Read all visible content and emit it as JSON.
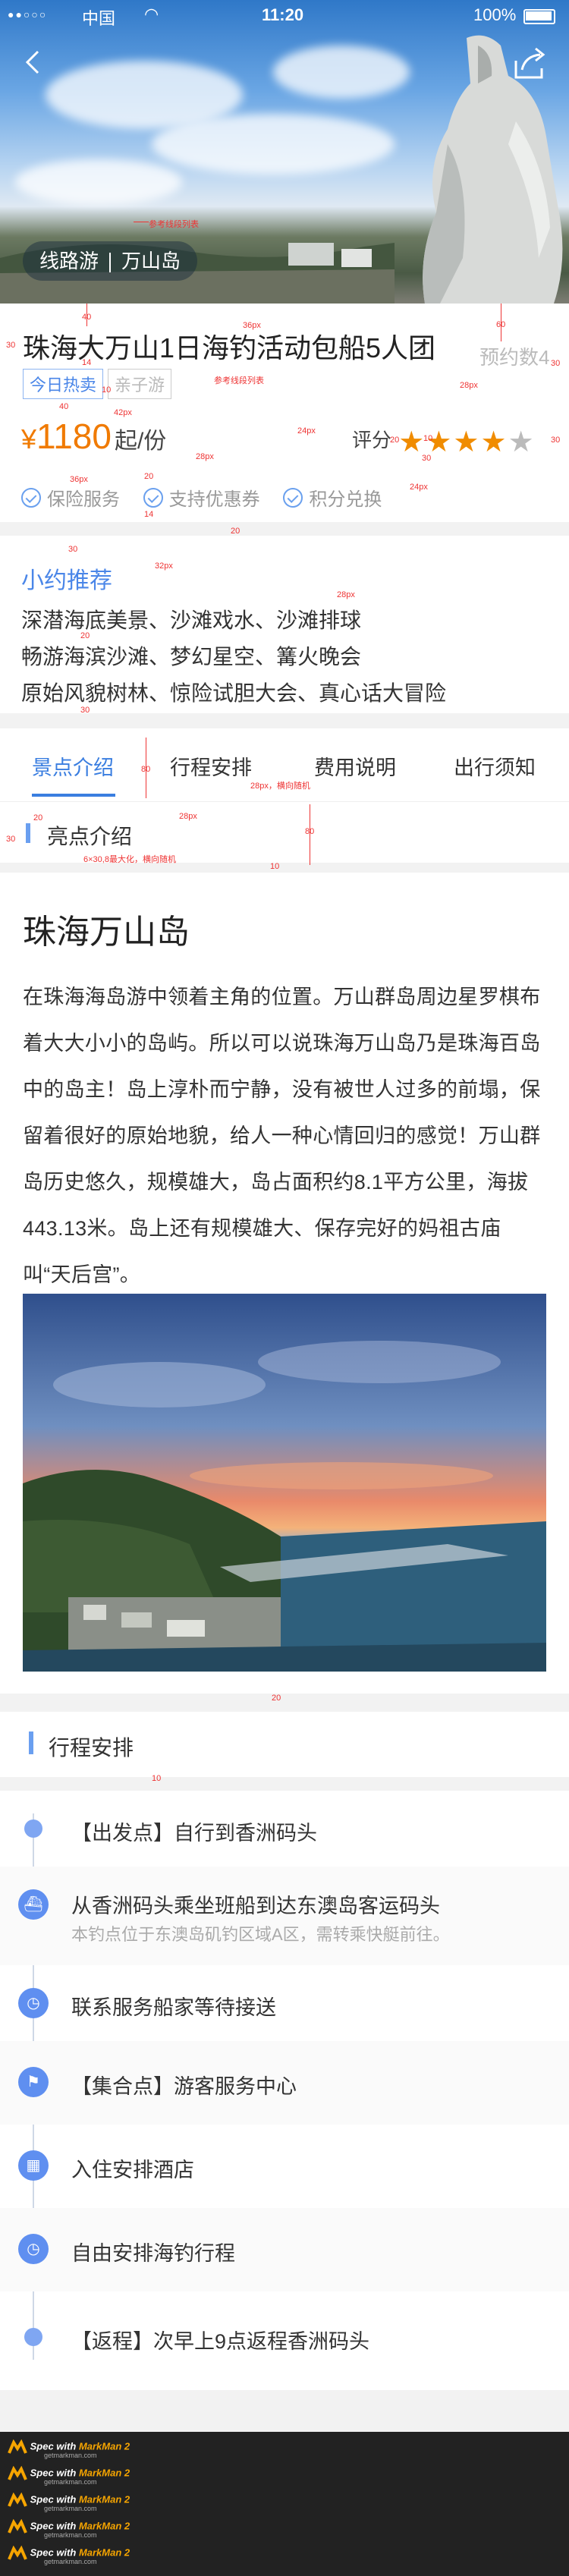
{
  "status_bar": {
    "signal": "●●○○○",
    "carrier": "中国",
    "time": "11:20",
    "battery": "100%"
  },
  "hero": {
    "tag_route": "线路游",
    "tag_place": "万山岛"
  },
  "product": {
    "title": "珠海大万山1日海钓活动包船5人团",
    "reserved": "预约数4",
    "tags": [
      "今日热卖",
      "亲子游"
    ],
    "price_symbol": "¥",
    "price": "1180",
    "price_unit": "起/份",
    "rating_label": "评分",
    "rating": 4,
    "rating_max": 5,
    "services": [
      "保险服务",
      "支持优惠券",
      "积分兑换"
    ]
  },
  "recommend": {
    "heading": "小约推荐",
    "lines": [
      "深潜海底美景、沙滩戏水、沙滩排球",
      "畅游海滨沙滩、梦幻星空、篝火晚会",
      "原始风貌树林、惊险试胆大会、真心话大冒险"
    ]
  },
  "tabs": [
    "景点介绍",
    "行程安排",
    "费用说明",
    "出行须知"
  ],
  "highlights_title": "亮点介绍",
  "article": {
    "title": "珠海万山岛",
    "body": "在珠海海岛游中领着主角的位置。万山群岛周边星罗棋布着大大小小的岛屿。所以可以说珠海万山岛乃是珠海百岛中的岛主！岛上淳朴而宁静，没有被世人过多的前塌，保留着很好的原始地貌，给人一种心情回归的感觉！万山群岛历史悠久，规模雄大，岛占面积约8.1平方公里，海拔443.13米。岛上还有规模雄大、保存完好的妈祖古庙叫“天后宫”。"
  },
  "itinerary": {
    "title": "行程安排",
    "items": [
      {
        "icon": "dot",
        "title": "【出发点】自行到香洲码头",
        "sub": ""
      },
      {
        "icon": "ship-icon",
        "title": "从香洲码头乘坐班船到达东澳岛客运码头",
        "sub": "本钓点位于东澳岛矶钓区域A区，需转乘快艇前往。"
      },
      {
        "icon": "clock-icon",
        "title": "联系服务船家等待接送",
        "sub": ""
      },
      {
        "icon": "flag-icon",
        "title": "【集合点】游客服务中心",
        "sub": ""
      },
      {
        "icon": "hotel-icon",
        "title": "入住安排酒店",
        "sub": ""
      },
      {
        "icon": "clock-icon",
        "title": "自由安排海钓行程",
        "sub": ""
      },
      {
        "icon": "dot",
        "title": "【返程】次早上9点返程香洲码头",
        "sub": ""
      }
    ]
  },
  "footer": {
    "spec_text": "Spec with",
    "brand": "MarkMan 2",
    "url": "getmarkman.com"
  },
  "annotations": {
    "a1": "参考线段列表",
    "a2": "36px",
    "a3": "参考线段列表",
    "a4": "30",
    "a5": "40",
    "a6": "14",
    "a7": "10",
    "a8": "60",
    "a9": "28px",
    "a10": "30",
    "a11": "40",
    "a12": "42px",
    "a13": "28px",
    "a14": "24px",
    "a15": "20",
    "a16": "10",
    "a17": "30",
    "a18": "30",
    "a19": "36px",
    "a20": "20",
    "a21": "14",
    "a22": "24px",
    "a23": "20",
    "a24": "30",
    "a25": "32px",
    "a26": "28px",
    "a27": "20",
    "a28": "30",
    "a29": "80",
    "a30": "28px，横向随机",
    "a31": "28px",
    "a32": "80",
    "a33": "20",
    "a34": "30",
    "a35": "6×30,8最大化，横向随机",
    "a36": "10",
    "a37": "20",
    "a38": "10",
    "a39": "24px",
    "a40": "30"
  },
  "colors": {
    "accent": "#4a86e8",
    "price": "#f07a00",
    "star": "#f08c00"
  }
}
